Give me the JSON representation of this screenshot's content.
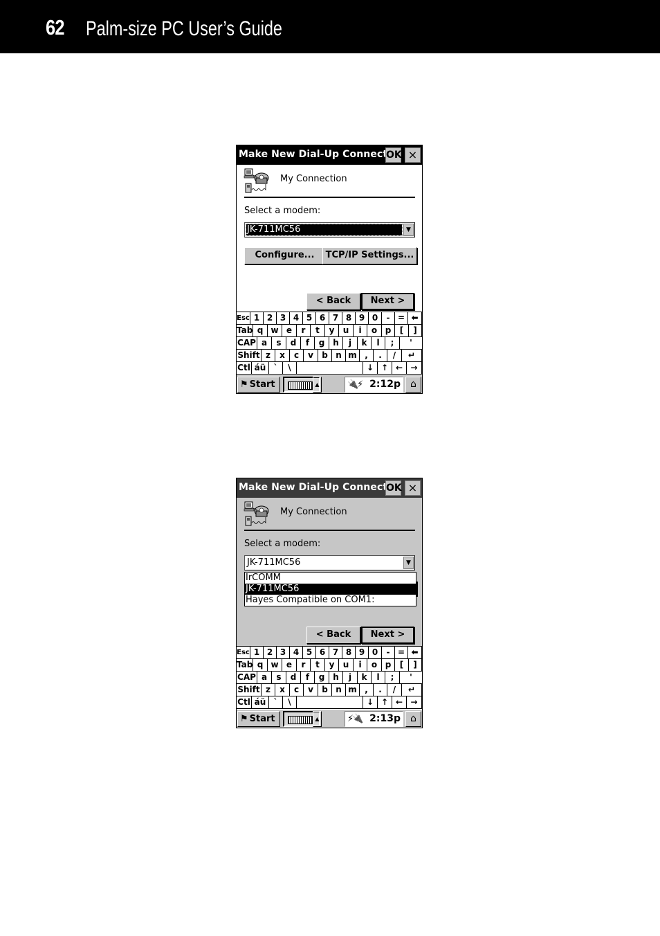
{
  "page": {
    "number": "62",
    "title": "Palm-size PC User’s Guide"
  },
  "screens": [
    {
      "state": "modem-selected",
      "dialog": {
        "title": "Make New Dial-Up Connect...",
        "ok_label": "OK",
        "close_label": "×",
        "icon": "dial-up-connection-icon",
        "connection_name": "My Connection",
        "modem_label": "Select a modem:",
        "modem_value": "JK-711MC56",
        "configure_label": "Configure...",
        "tcpip_label": "TCP/IP Settings...",
        "back_label": "< Back",
        "next_label": "Next >"
      },
      "taskbar": {
        "start_label": "Start",
        "time": "2:12p",
        "tray_icons": [
          "power-plug-icon",
          "network-icon"
        ]
      }
    },
    {
      "state": "dropdown-open",
      "dialog": {
        "title": "Make New Dial-Up Connect...",
        "ok_label": "OK",
        "close_label": "×",
        "icon": "dial-up-connection-icon",
        "connection_name": "My Connection",
        "modem_label": "Select a modem:",
        "modem_value": "JK-711MC56",
        "modem_options": [
          "IrCOMM",
          "JK-711MC56",
          "Hayes Compatible on COM1:"
        ],
        "modem_selected_index": 1,
        "back_label": "< Back",
        "next_label": "Next >"
      },
      "taskbar": {
        "start_label": "Start",
        "time": "2:13p",
        "tray_icons": [
          "network-icon",
          "power-plug-icon"
        ]
      }
    }
  ],
  "keyboard": {
    "rows": [
      [
        "Esc",
        "1",
        "2",
        "3",
        "4",
        "5",
        "6",
        "7",
        "8",
        "9",
        "0",
        "-",
        "=",
        "←back"
      ],
      [
        "Tab",
        "q",
        "w",
        "e",
        "r",
        "t",
        "y",
        "u",
        "i",
        "o",
        "p",
        "[",
        "]"
      ],
      [
        "CAP",
        "a",
        "s",
        "d",
        "f",
        "g",
        "h",
        "j",
        "k",
        "l",
        ";",
        "'"
      ],
      [
        "Shift",
        "z",
        "x",
        "c",
        "v",
        "b",
        "n",
        "m",
        ",",
        ".",
        "/",
        "↵"
      ],
      [
        "Ctl",
        "áü",
        "`",
        "\\",
        " ",
        "↓",
        "↑",
        "←",
        "→"
      ]
    ]
  }
}
